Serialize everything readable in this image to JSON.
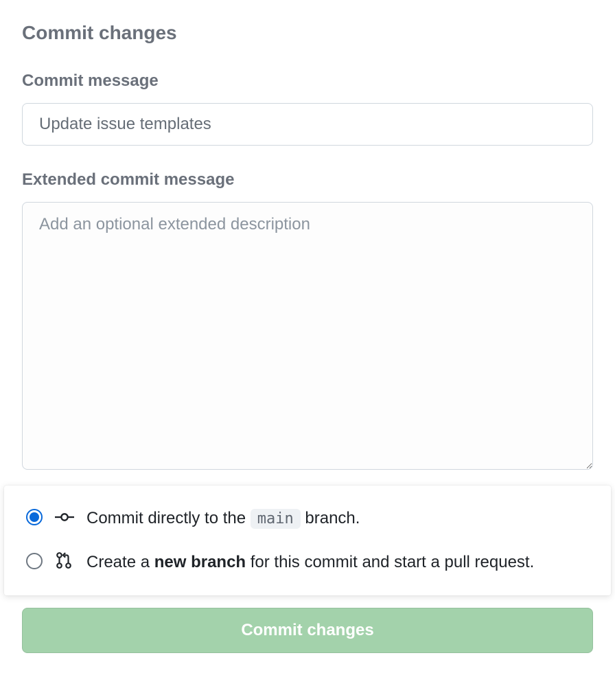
{
  "heading": "Commit changes",
  "fields": {
    "commit_message_label": "Commit message",
    "commit_message_value": "Update issue templates",
    "extended_label": "Extended commit message",
    "extended_placeholder": "Add an optional extended description"
  },
  "radios": {
    "direct_prefix": "Commit directly to the ",
    "direct_branch": "main",
    "direct_suffix": " branch.",
    "new_prefix": "Create a ",
    "new_bold": "new branch",
    "new_suffix": " for this commit and start a pull request."
  },
  "button": {
    "label": "Commit changes"
  }
}
